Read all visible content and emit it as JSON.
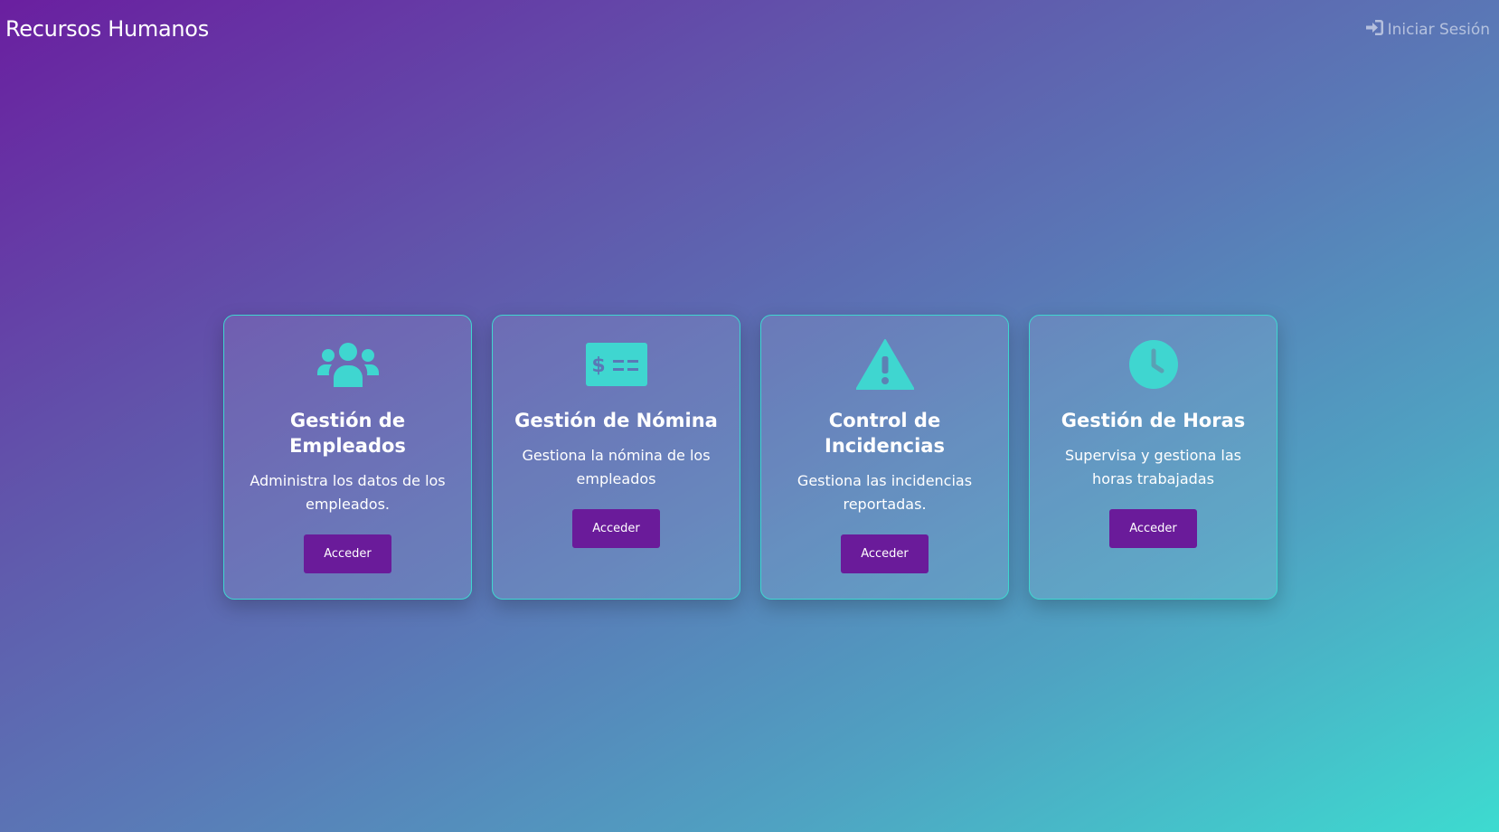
{
  "header": {
    "brand": "Recursos Humanos",
    "login_label": "Iniciar Sesión",
    "login_icon": "sign-in-icon"
  },
  "colors": {
    "accent_teal": "#3fd6d0",
    "button_purple": "#6a1b9a",
    "gradient_start": "#6a1fa0",
    "gradient_end": "#3ddbd0"
  },
  "cards": [
    {
      "icon": "users-icon",
      "title": "Gestión de Empleados",
      "description": "Administra los datos de los empleados.",
      "button_label": "Acceder"
    },
    {
      "icon": "money-check-icon",
      "title": "Gestión de Nómina",
      "description": "Gestiona la nómina de los empleados",
      "button_label": "Acceder"
    },
    {
      "icon": "warning-icon",
      "title": "Control de Incidencias",
      "description": "Gestiona las incidencias reportadas.",
      "button_label": "Acceder"
    },
    {
      "icon": "clock-icon",
      "title": "Gestión de Horas",
      "description": "Supervisa y gestiona las horas trabajadas",
      "button_label": "Acceder"
    }
  ]
}
